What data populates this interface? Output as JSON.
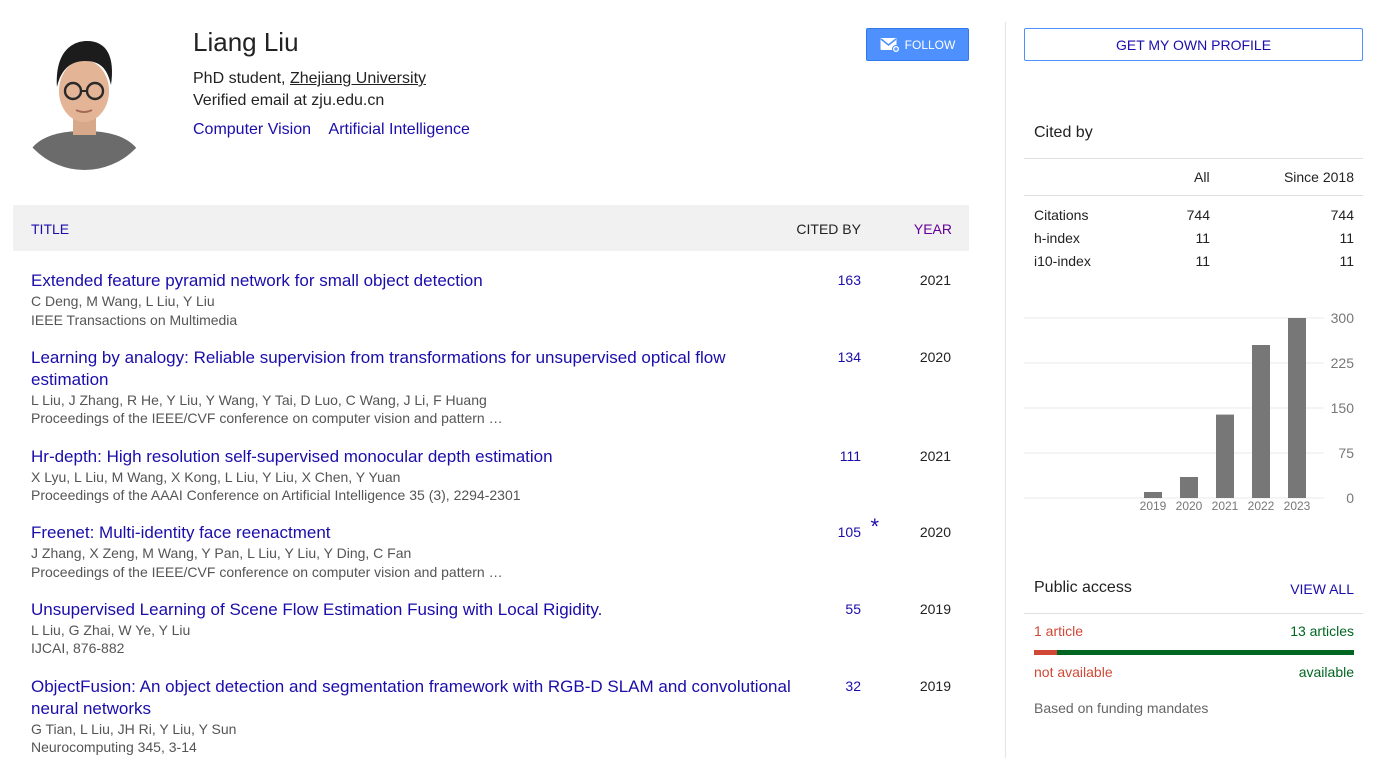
{
  "profile": {
    "name": "Liang Liu",
    "position": "PhD student,",
    "university": "Zhejiang University",
    "email": "Verified email at zju.edu.cn",
    "interests": [
      "Computer Vision",
      "Artificial Intelligence"
    ],
    "follow_label": "FOLLOW"
  },
  "table": {
    "col_title": "TITLE",
    "col_cited": "CITED BY",
    "col_year": "YEAR",
    "rows": [
      {
        "title": "Extended feature pyramid network for small object detection",
        "authors": "C Deng, M Wang, L Liu, Y Liu",
        "venue": "IEEE Transactions on Multimedia",
        "cited": "163",
        "year": "2021"
      },
      {
        "title": "Learning by analogy: Reliable supervision from transformations for unsupervised optical flow estimation",
        "authors": "L Liu, J Zhang, R He, Y Liu, Y Wang, Y Tai, D Luo, C Wang, J Li, F Huang",
        "venue": "Proceedings of the IEEE/CVF conference on computer vision and pattern …",
        "cited": "134",
        "year": "2020"
      },
      {
        "title": "Hr-depth: High resolution self-supervised monocular depth estimation",
        "authors": "X Lyu, L Liu, M Wang, X Kong, L Liu, Y Liu, X Chen, Y Yuan",
        "venue": "Proceedings of the AAAI Conference on Artificial Intelligence 35 (3), 2294-2301",
        "cited": "111",
        "year": "2021"
      },
      {
        "title": "Freenet: Multi-identity face reenactment",
        "authors": "J Zhang, X Zeng, M Wang, Y Pan, L Liu, Y Liu, Y Ding, C Fan",
        "venue": "Proceedings of the IEEE/CVF conference on computer vision and pattern …",
        "cited": "105",
        "star": "*",
        "year": "2020"
      },
      {
        "title": "Unsupervised Learning of Scene Flow Estimation Fusing with Local Rigidity.",
        "authors": "L Liu, G Zhai, W Ye, Y Liu",
        "venue": "IJCAI, 876-882",
        "cited": "55",
        "year": "2019"
      },
      {
        "title": "ObjectFusion: An object detection and segmentation framework with RGB-D SLAM and convolutional neural networks",
        "authors": "G Tian, L Liu, JH Ri, Y Liu, Y Sun",
        "venue": "Neurocomputing 345, 3-14",
        "cited": "32",
        "year": "2019"
      }
    ]
  },
  "sidebar": {
    "get_profile_label": "GET MY OWN PROFILE",
    "cited_by_title": "Cited by",
    "col_all": "All",
    "col_since": "Since 2018",
    "metrics": [
      {
        "label": "Citations",
        "all": "744",
        "since": "744"
      },
      {
        "label": "h-index",
        "all": "11",
        "since": "11"
      },
      {
        "label": "i10-index",
        "all": "11",
        "since": "11"
      }
    ],
    "public_access": {
      "title": "Public access",
      "view_all": "VIEW ALL",
      "left_count": "1 article",
      "right_count": "13 articles",
      "unavailable_label": "not available",
      "available_label": "available",
      "unavailable_fraction": 0.071,
      "note": "Based on funding mandates"
    }
  },
  "chart_data": {
    "type": "bar",
    "categories": [
      "2019",
      "2020",
      "2021",
      "2022",
      "2023"
    ],
    "values": [
      10,
      35,
      139,
      255,
      300
    ],
    "ylim": [
      0,
      300
    ],
    "yticks": [
      0,
      75,
      150,
      225,
      300
    ],
    "grid": true,
    "bar_color": "#777777"
  }
}
